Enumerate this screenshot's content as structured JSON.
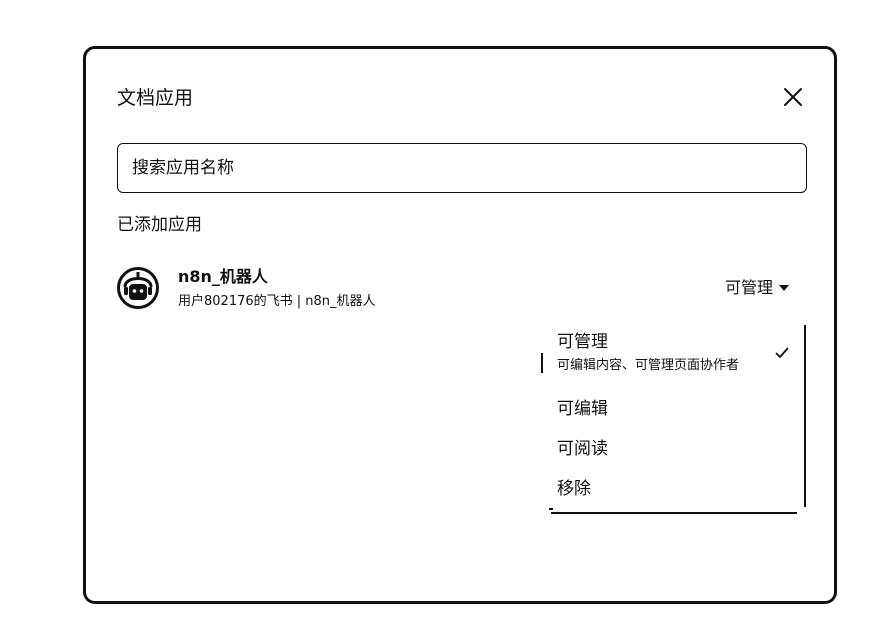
{
  "dialog": {
    "title": "文档应用",
    "close_icon": "close-icon",
    "search": {
      "placeholder": "搜索应用名称",
      "value": ""
    },
    "section_label": "已添加应用"
  },
  "app": {
    "avatar_icon": "robot-avatar-icon",
    "name": "n8n_机器人",
    "owner": "用户802176的飞书 | n8n_机器人",
    "permission": "可管理"
  },
  "permission_menu": {
    "selected": "可管理",
    "check_icon": "checkmark-icon",
    "items": [
      {
        "label": "可管理",
        "description": "可编辑内容、可管理页面协作者"
      },
      {
        "label": "可编辑"
      },
      {
        "label": "可阅读"
      },
      {
        "label": "移除"
      }
    ]
  },
  "colors": {
    "foreground": "#111111",
    "background": "#ffffff"
  }
}
